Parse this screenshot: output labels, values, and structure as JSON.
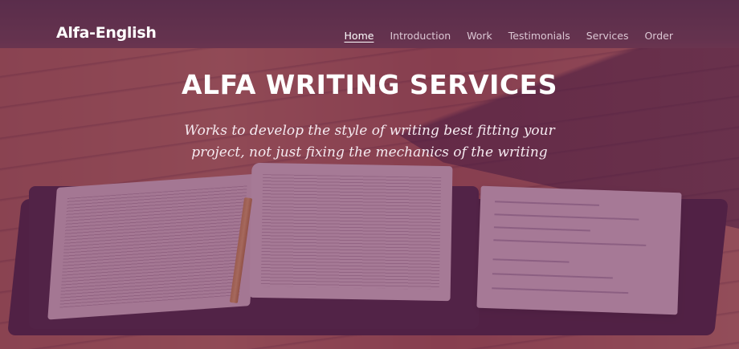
{
  "brand": {
    "name": "Alfa-English"
  },
  "nav": {
    "items": [
      {
        "label": "Home",
        "active": true
      },
      {
        "label": "Introduction",
        "active": false
      },
      {
        "label": "Work",
        "active": false
      },
      {
        "label": "Testimonials",
        "active": false
      },
      {
        "label": "Services",
        "active": false
      },
      {
        "label": "Order",
        "active": false
      }
    ]
  },
  "hero": {
    "title": "ALFA WRITING SERVICES",
    "subtitle": "Works to develop the style of writing best fitting your project, not just fixing the mechanics of the writing"
  },
  "colors": {
    "overlay_tint": "#6e285f",
    "text_primary": "#ffffff"
  }
}
